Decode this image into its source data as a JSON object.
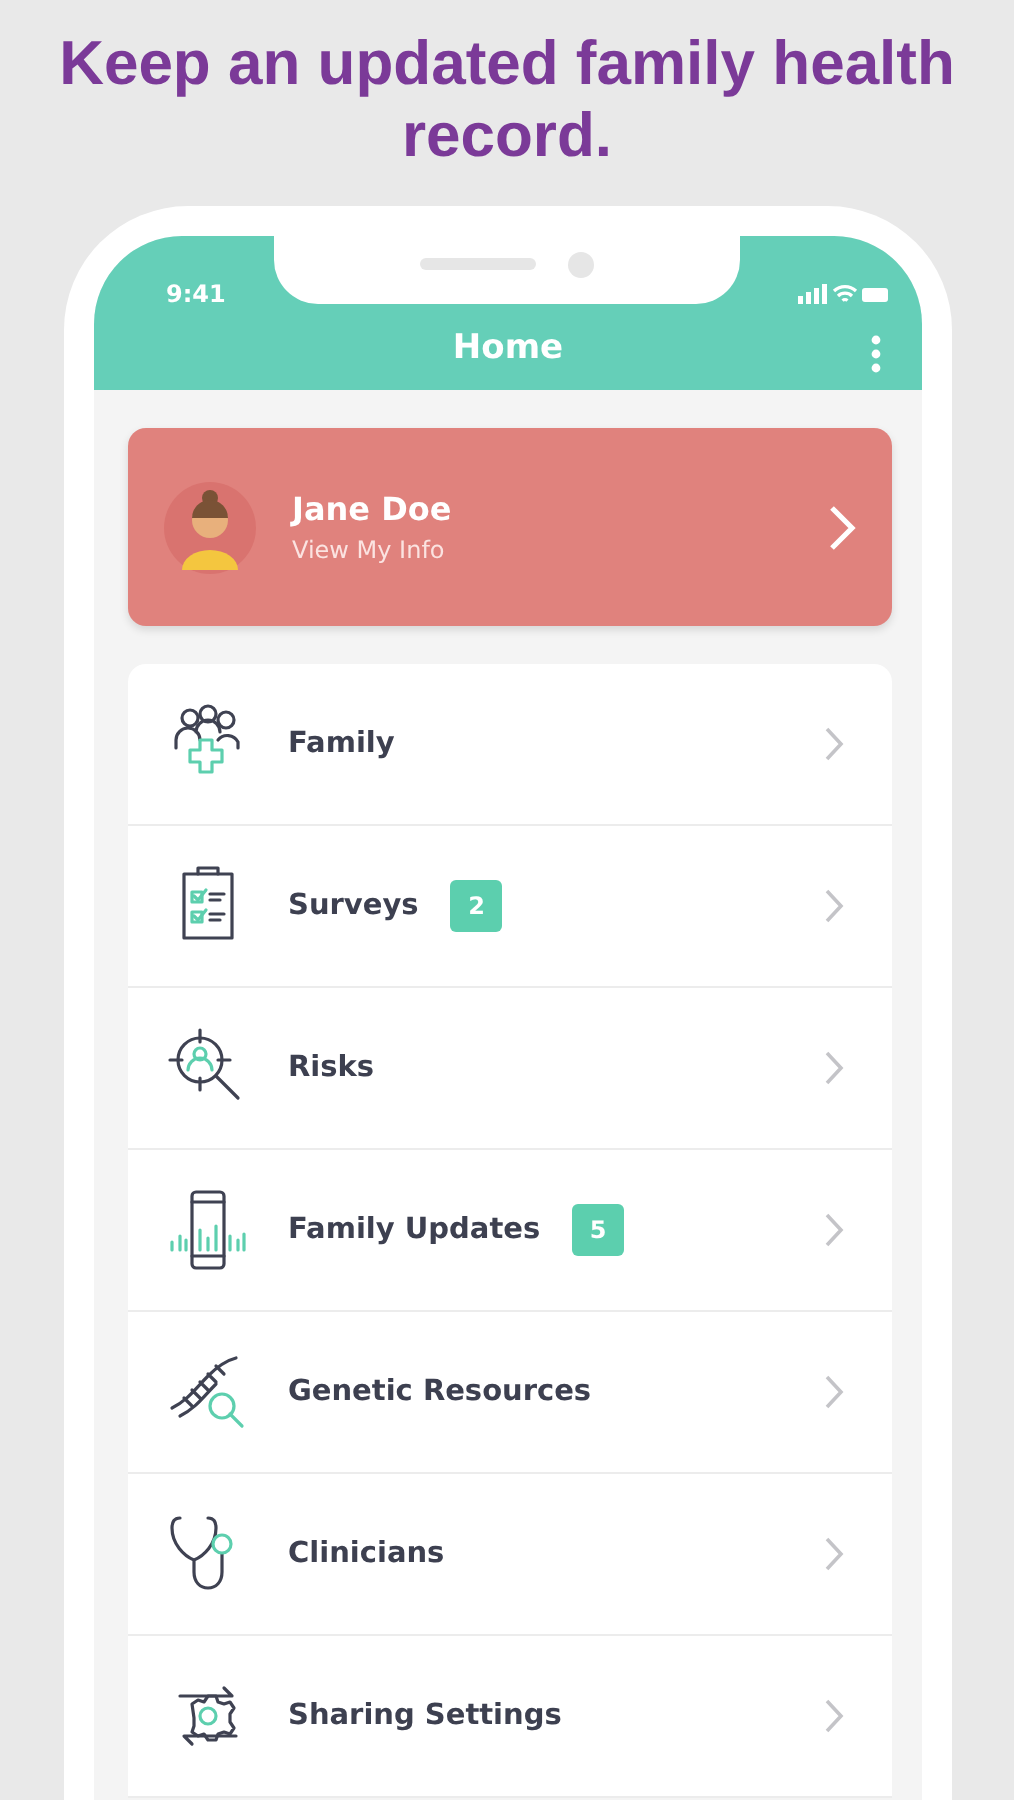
{
  "headline": "Keep an updated family health record.",
  "status_bar": {
    "time": "9:41"
  },
  "header": {
    "title": "Home"
  },
  "profile": {
    "name": "Jane Doe",
    "subtitle": "View My Info"
  },
  "menu_items": [
    {
      "kind": "family",
      "label": "Family"
    },
    {
      "kind": "surveys",
      "label": "Surveys",
      "badge": "2"
    },
    {
      "kind": "risks",
      "label": "Risks"
    },
    {
      "kind": "updates",
      "label": "Family Updates",
      "badge": "5"
    },
    {
      "kind": "genetics",
      "label": "Genetic Resources"
    },
    {
      "kind": "clinicians",
      "label": "Clinicians"
    },
    {
      "kind": "sharing",
      "label": "Sharing Settings"
    }
  ]
}
